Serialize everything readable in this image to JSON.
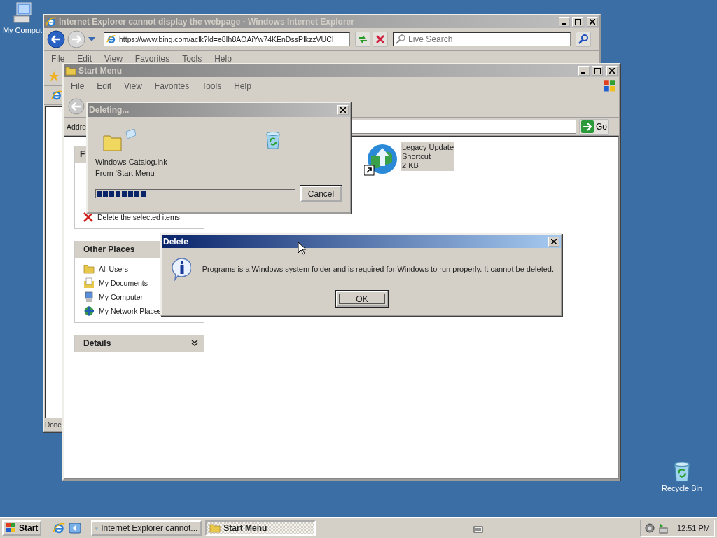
{
  "desktop": {
    "icons": [
      {
        "label": "My Comput",
        "kind": "computer"
      },
      {
        "label": "Recycle Bin",
        "kind": "recycle"
      }
    ]
  },
  "ie_window": {
    "title": "Internet Explorer cannot display the webpage - Windows Internet Explorer",
    "active": false,
    "address": "https://www.bing.com/aclk?ld=e8Ih8AOAiYw74KEnDssPIkzzVUCI",
    "search": {
      "placeholder": "Live Search"
    },
    "menu": [
      "File",
      "Edit",
      "View",
      "Favorites",
      "Tools",
      "Help"
    ],
    "status": "Done"
  },
  "explorer_window": {
    "title": "Start Menu",
    "active": false,
    "menu": [
      "File",
      "Edit",
      "View",
      "Favorites",
      "Tools",
      "Help"
    ],
    "address_label": "Addre",
    "go": "Go",
    "task_panels": [
      {
        "title": "F",
        "items": [
          {
            "label": "Delete the selected items",
            "kind": "delete"
          }
        ]
      },
      {
        "title": "Other Places",
        "items": [
          {
            "label": "All Users",
            "kind": "folder"
          },
          {
            "label": "My Documents",
            "kind": "documents"
          },
          {
            "label": "My Computer",
            "kind": "computer"
          },
          {
            "label": "My Network Places",
            "kind": "network"
          }
        ]
      },
      {
        "title": "Details"
      }
    ],
    "files": [
      {
        "name": "Legacy Update",
        "type": "Shortcut",
        "size": "2 KB",
        "selected": true
      }
    ]
  },
  "progress_dialog": {
    "title": "Deleting...",
    "active": false,
    "file": "Windows Catalog.lnk",
    "from": "From 'Start Menu'",
    "level": 0.25,
    "button": "Cancel"
  },
  "message_dialog": {
    "title": "Delete",
    "active": true,
    "message": "Programs is a Windows system folder and is required for Windows to run properly. It cannot be deleted.",
    "button": "OK"
  },
  "taskbar": {
    "start": "Start",
    "tasks": [
      {
        "label": "Internet Explorer cannot...",
        "kind": "browser",
        "selected": false
      },
      {
        "label": "Start Menu",
        "kind": "folder",
        "selected": true
      }
    ],
    "clock": "12:51 PM"
  }
}
